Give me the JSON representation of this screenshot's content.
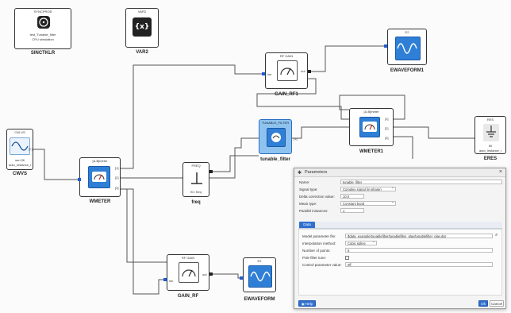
{
  "dialog": {
    "title": "Parameters",
    "fields": [
      {
        "label": "Name:",
        "value": "tunable_filter"
      },
      {
        "label": "Signal type:",
        "value": "Complex signal (in-phase)"
      },
      {
        "label": "Delta correction value:",
        "value": "10.0"
      },
      {
        "label": "Mean type:",
        "value": "Constant band"
      },
      {
        "label": "Parallel instances:",
        "value": "1"
      }
    ],
    "tab_label": "Data",
    "data_fields": [
      {
        "label": "Model parameter file:",
        "value": "$data_example/tunablefilter/tunablefilter_play/tunablefilter_play.dat"
      },
      {
        "label": "Interpolation method:",
        "value": "Cubic spline"
      },
      {
        "label": "Number of points:",
        "value": "5"
      },
      {
        "label": "Pole filter tune:",
        "value": ""
      },
      {
        "label": "Control parameter value:",
        "value": "0ff"
      }
    ],
    "help_label": "Help",
    "ok_label": "Ok",
    "cancel_label": "Cancel",
    "search_icon": "search-icon"
  },
  "blocks": {
    "syncprob": {
      "caption": "SYNCPROB",
      "sub1": "test_Tunable_filter",
      "sub2": "CPU simulation",
      "name": "SINCTKLR"
    },
    "var2": {
      "caption": "VAR2",
      "symbol": "{x}",
      "name": "VAR2"
    },
    "cwvs": {
      "caption": "CW-VS",
      "sub1": "sw=36",
      "sub2": "auto_instance_l",
      "name": "CWVS",
      "port": "[+]"
    },
    "wmeter": {
      "caption": "[A,B]meter",
      "name": "WMETER",
      "ports": [
        "[1]",
        "[2]",
        "[3]"
      ]
    },
    "gain_rf1": {
      "caption": "RF GAIN",
      "name": "GAIN_RF1",
      "port_in": "inn",
      "port_out": "out"
    },
    "ewaveform1": {
      "caption": "E2",
      "name": "EWAVEFORM1"
    },
    "tunable": {
      "caption": "TUNABLE_FILTER",
      "name": "tunable_filter",
      "port_out": "[1]"
    },
    "freq": {
      "caption": "FREQ",
      "sub": "f0= freq",
      "name": "freq"
    },
    "wmeter1": {
      "caption": "[A,B]meter",
      "name": "WMETER1",
      "ports": [
        "[1]",
        "[2]",
        "[3]"
      ]
    },
    "res": {
      "caption": "RES",
      "sub1": "50",
      "sub2": "auto_instance_l",
      "name": "ЕRES"
    },
    "gain_rf": {
      "caption": "RF GAIN",
      "name": "GAIN_RF",
      "port_in": "inn",
      "port_out": "out"
    },
    "ewaveform": {
      "caption": "E2",
      "name": "EWAVEFORM"
    }
  },
  "colors": {
    "accent": "#2f6fcf",
    "wire": "#555555",
    "block_fill": "#2f7fd6"
  }
}
